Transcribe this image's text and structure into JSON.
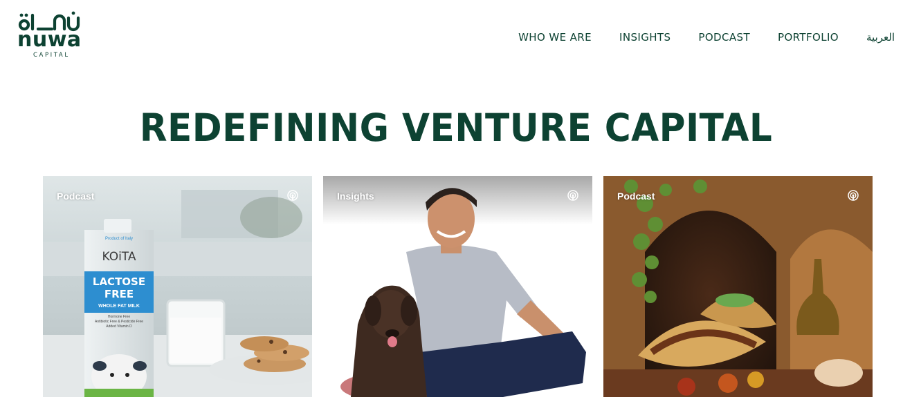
{
  "brand": {
    "arabic_name": "نواة",
    "latin_name": "nuwa",
    "subtitle": "CAPITAL"
  },
  "nav": {
    "items": [
      {
        "label": "WHO WE ARE"
      },
      {
        "label": "INSIGHTS"
      },
      {
        "label": "PODCAST"
      },
      {
        "label": "PORTFOLIO"
      },
      {
        "label": "العربية"
      }
    ]
  },
  "hero": {
    "title": "REDEFINING VENTURE CAPITAL"
  },
  "cards": [
    {
      "tag": "Podcast",
      "icon": "podcast-icon",
      "image": {
        "brand": "KOiTA",
        "origin": "Product of Italy",
        "headline_1": "LACTOSE",
        "headline_2": "FREE",
        "variant": "WHOLE FAT MILK",
        "claims": [
          "Hormone Free",
          "Antibiotic Free & Pesticide Free",
          "Added Vitamin D"
        ]
      }
    },
    {
      "tag": "Insights",
      "icon": "podcast-icon"
    },
    {
      "tag": "Podcast",
      "icon": "podcast-icon"
    }
  ],
  "colors": {
    "brand_green": "#0d4232",
    "white": "#ffffff"
  }
}
